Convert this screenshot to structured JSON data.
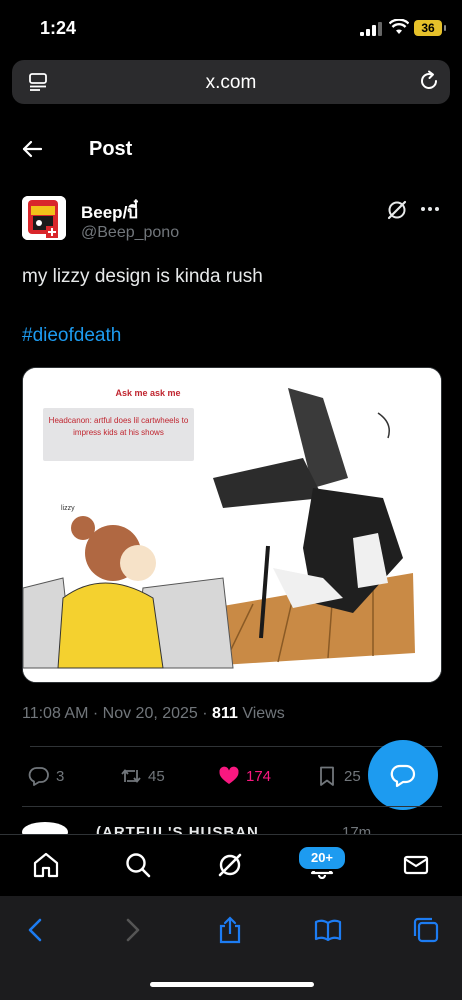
{
  "status_bar": {
    "time": "1:24",
    "battery": "36"
  },
  "url_bar": {
    "domain": "x.com"
  },
  "header": {
    "title": "Post"
  },
  "author": {
    "name": "Beep/บี๋",
    "handle": "@Beep_pono"
  },
  "post": {
    "text": "my lizzy design is kinda rush",
    "hashtag": "#dieofdeath",
    "media": {
      "title": "Ask me ask me",
      "caption": "Headcanon: artful does lil cartwheels to impress kids at his shows",
      "note": "lizzy"
    },
    "time": "11:08 AM",
    "date": "Nov 20, 2025",
    "views_count": "811",
    "views_label": "Views"
  },
  "actions": {
    "replies": "3",
    "reposts": "45",
    "likes": "174",
    "bookmarks": "25"
  },
  "next_reply": {
    "name_partial": "(ARTFUL'S HUSBAN",
    "time_partial": "17m"
  },
  "bottom_nav": {
    "notifications_badge": "20+"
  },
  "colors": {
    "accent": "#1d9bf0",
    "like": "#f91880",
    "muted": "#71767b",
    "background": "#000000"
  },
  "icons": [
    "back-arrow-icon",
    "grok-icon",
    "more-icon",
    "reply-icon",
    "repost-icon",
    "heart-icon",
    "bookmark-icon",
    "compose-icon",
    "home-icon",
    "search-icon",
    "bell-icon",
    "mail-icon"
  ]
}
